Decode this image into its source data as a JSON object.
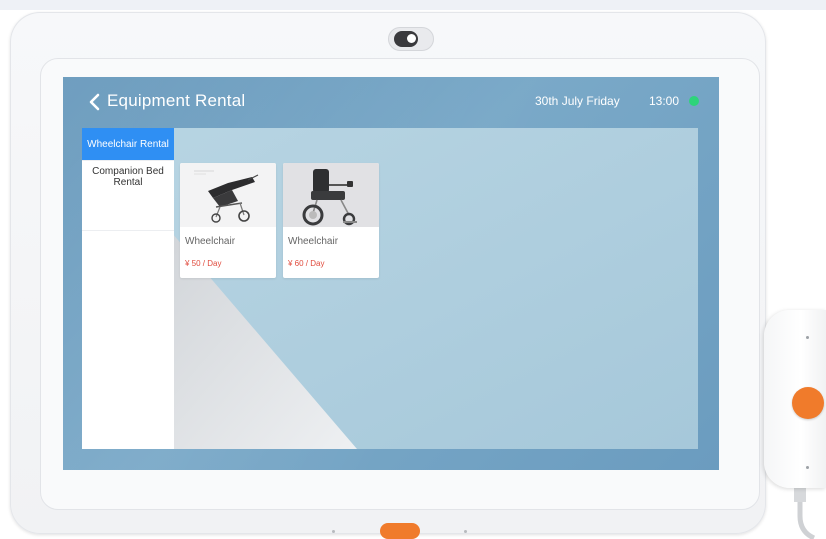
{
  "header": {
    "title": "Equipment Rental",
    "date": "30th July Friday",
    "time": "13:00"
  },
  "sidebar": {
    "items": [
      {
        "label": "Wheelchair Rental",
        "active": true
      },
      {
        "label": "Companion Bed Rental",
        "active": false
      }
    ]
  },
  "products": [
    {
      "name": "Wheelchair",
      "price": "¥ 50 / Day"
    },
    {
      "name": "Wheelchair",
      "price": "¥ 60 / Day"
    }
  ],
  "colors": {
    "accent": "#2f8ff3",
    "price": "#e04a3c",
    "status": "#2ed47a",
    "hardware_button": "#f07b2b"
  },
  "icons": [
    "back-chevron-icon",
    "camera-icon",
    "status-online-icon"
  ]
}
